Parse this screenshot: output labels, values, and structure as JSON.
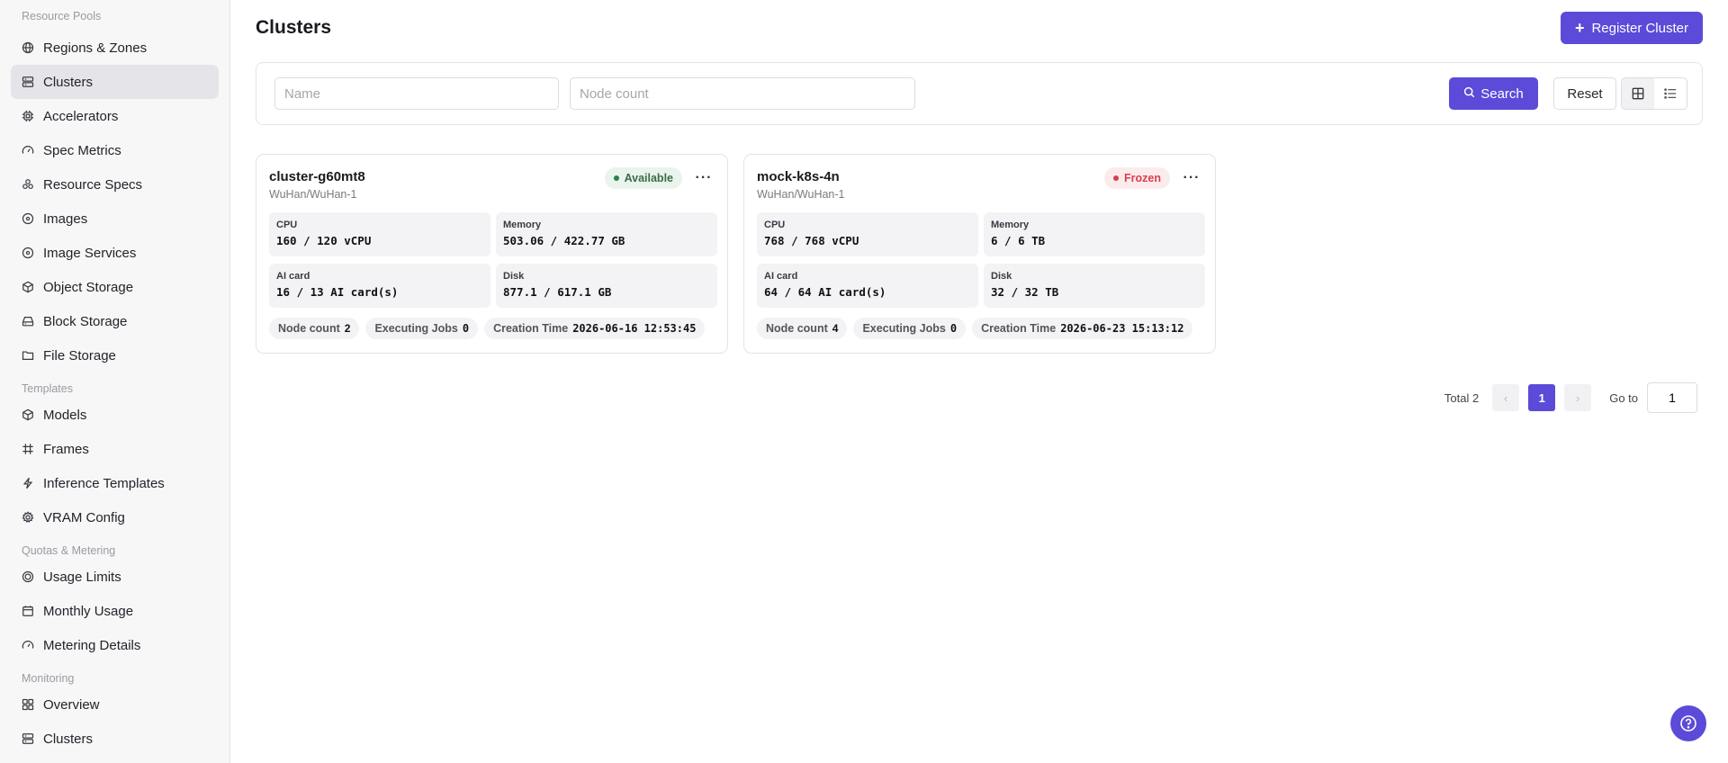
{
  "sidebar": {
    "sections": [
      {
        "title": "Resource Pools",
        "items": [
          {
            "label": "Regions & Zones",
            "icon": "globe-icon"
          },
          {
            "label": "Clusters",
            "icon": "server-icon",
            "active": true
          },
          {
            "label": "Accelerators",
            "icon": "chip-icon"
          },
          {
            "label": "Spec Metrics",
            "icon": "gauge-icon"
          },
          {
            "label": "Resource Specs",
            "icon": "layers-icon"
          },
          {
            "label": "Images",
            "icon": "disc-icon"
          },
          {
            "label": "Image Services",
            "icon": "disc-icon"
          },
          {
            "label": "Object Storage",
            "icon": "cube-icon"
          },
          {
            "label": "Block Storage",
            "icon": "hdd-icon"
          },
          {
            "label": "File Storage",
            "icon": "folder-icon"
          }
        ]
      },
      {
        "title": "Templates",
        "items": [
          {
            "label": "Models",
            "icon": "cube-icon"
          },
          {
            "label": "Frames",
            "icon": "hash-icon"
          },
          {
            "label": "Inference Templates",
            "icon": "bolt-icon"
          },
          {
            "label": "VRAM Config",
            "icon": "gear-icon"
          }
        ]
      },
      {
        "title": "Quotas & Metering",
        "items": [
          {
            "label": "Usage Limits",
            "icon": "coin-icon"
          },
          {
            "label": "Monthly Usage",
            "icon": "calendar-icon"
          },
          {
            "label": "Metering Details",
            "icon": "gauge-icon"
          }
        ]
      },
      {
        "title": "Monitoring",
        "items": [
          {
            "label": "Overview",
            "icon": "dashboard-icon"
          },
          {
            "label": "Clusters",
            "icon": "server-icon"
          }
        ]
      }
    ]
  },
  "header": {
    "title": "Clusters",
    "register_label": "Register Cluster"
  },
  "filters": {
    "name_placeholder": "Name",
    "name_value": "",
    "node_placeholder": "Node count",
    "node_value": "",
    "search_label": "Search",
    "reset_label": "Reset",
    "view_mode": "grid"
  },
  "clusters": [
    {
      "name": "cluster-g60mt8",
      "location": "WuHan/WuHan-1",
      "status": "Available",
      "status_color": "#2e7d4a",
      "cpu_label": "CPU",
      "cpu_value": "160 / 120 vCPU",
      "memory_label": "Memory",
      "memory_value": "503.06 / 422.77 GB",
      "ai_label": "AI card",
      "ai_value": "16 / 13 AI card(s)",
      "disk_label": "Disk",
      "disk_value": "877.1 / 617.1 GB",
      "node_count_label": "Node count",
      "node_count": "2",
      "jobs_label": "Executing Jobs",
      "jobs": "0",
      "created_label": "Creation Time",
      "created": "2026-06-16 12:53:45"
    },
    {
      "name": "mock-k8s-4n",
      "location": "WuHan/WuHan-1",
      "status": "Frozen",
      "status_color": "#d6404c",
      "cpu_label": "CPU",
      "cpu_value": "768 / 768 vCPU",
      "memory_label": "Memory",
      "memory_value": "6 / 6 TB",
      "ai_label": "AI card",
      "ai_value": "64 / 64 AI card(s)",
      "disk_label": "Disk",
      "disk_value": "32 / 32 TB",
      "node_count_label": "Node count",
      "node_count": "4",
      "jobs_label": "Executing Jobs",
      "jobs": "0",
      "created_label": "Creation Time",
      "created": "2026-06-23 15:13:12"
    }
  ],
  "pagination": {
    "total_label": "Total 2",
    "current_page": "1",
    "goto_label": "Go to",
    "goto_value": "1"
  },
  "accent_color": "#5b4bd8"
}
